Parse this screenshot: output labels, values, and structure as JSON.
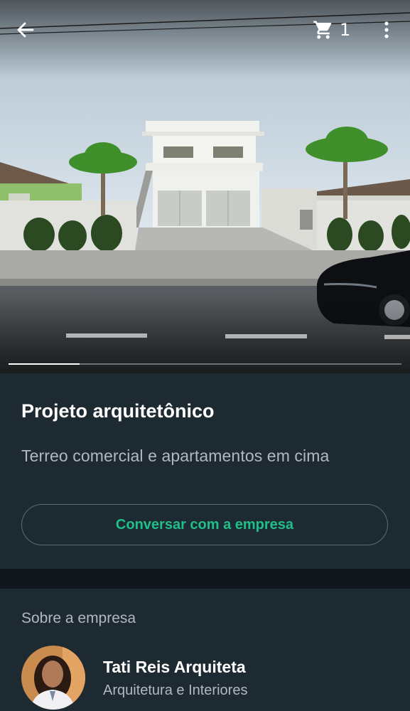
{
  "header": {
    "back_icon": "arrow-left-icon",
    "cart_icon": "shopping-cart-icon",
    "cart_count": "1",
    "menu_icon": "more-vertical-icon"
  },
  "carousel": {
    "progress": 0.18
  },
  "product": {
    "title": "Projeto arquitetônico",
    "description": "Terreo comercial e apartamentos em cima",
    "chat_button_label": "Conversar com a empresa"
  },
  "about": {
    "label": "Sobre a empresa",
    "company_name": "Tati Reis Arquiteta",
    "company_category": "Arquitetura e Interiores"
  },
  "colors": {
    "background": "#121b22",
    "card": "#1e2a32",
    "accent": "#1fbf8a",
    "text_secondary": "#aeb9c0"
  }
}
